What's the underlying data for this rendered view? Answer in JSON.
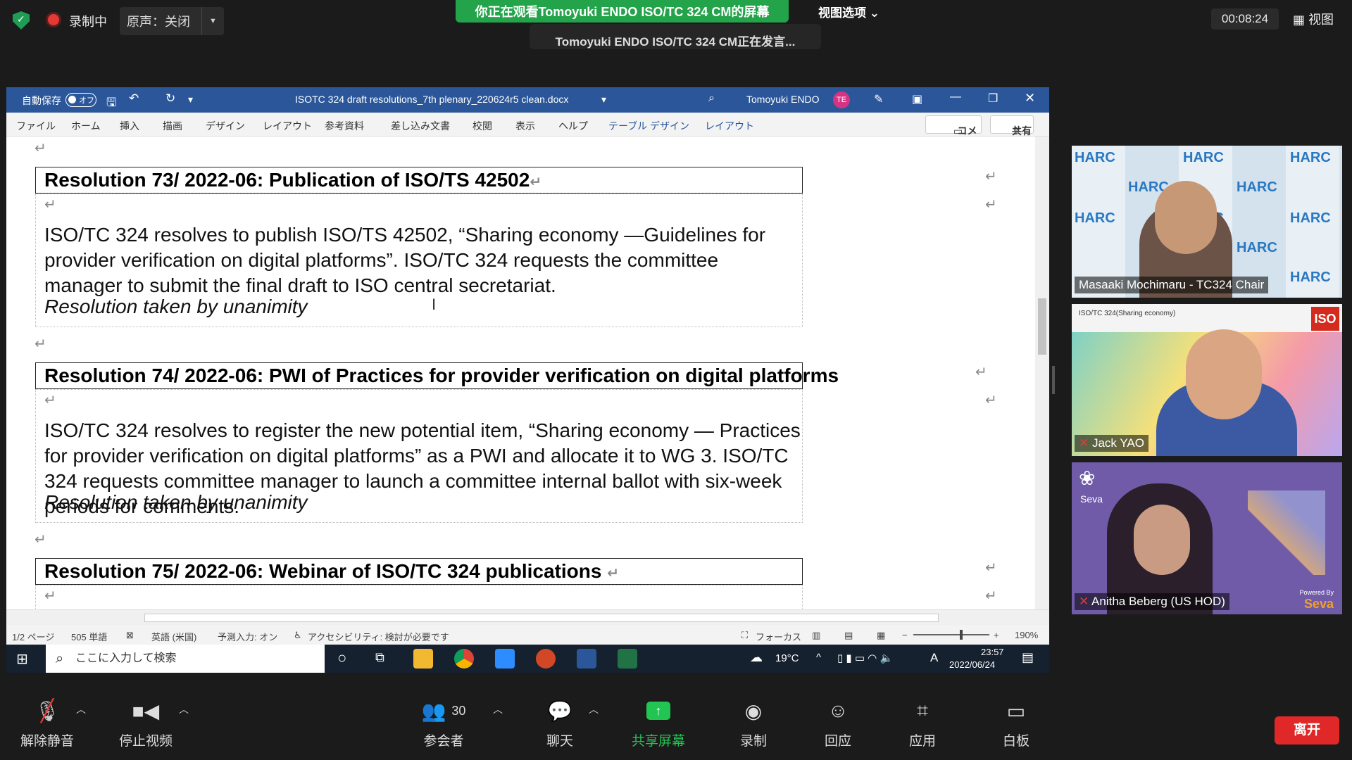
{
  "topbar": {
    "recording": "录制中",
    "original_sound": "原声：关闭",
    "viewing_banner": "你正在观看Tomoyuki ENDO ISO/TC 324 CM的屏幕",
    "speaking_banner": "Tomoyuki ENDO ISO/TC 324 CM正在发言...",
    "view_options": "视图选项 ⌄",
    "timer": "00:08:24",
    "view_button": "视图"
  },
  "word": {
    "autosave_label": "自動保存",
    "autosave_state": "オフ",
    "doc_title": "ISOTC 324 draft resolutions_7th plenary_220624r5 clean.docx",
    "user_name": "Tomoyuki ENDO",
    "user_initials": "TE",
    "menu": [
      "ファイル",
      "ホーム",
      "挿入",
      "描画",
      "デザイン",
      "レイアウト",
      "参考資料",
      "差し込み文書",
      "校閲",
      "表示",
      "ヘルプ",
      "テーブル デザイン",
      "レイアウト"
    ],
    "comment_button": "コメント",
    "share_button": "共有",
    "paragraph_mark": "↵",
    "resolutions": [
      {
        "heading": "Resolution 73/ 2022-06: Publication of ISO/TS 42502",
        "body": "ISO/TC 324 resolves to publish ISO/TS 42502, “Sharing economy —Guidelines for provider verification on digital platforms”. ISO/TC 324 requests the committee manager to submit the final draft to ISO central secretariat.",
        "taken": "Resolution taken by unanimity"
      },
      {
        "heading": "Resolution 74/ 2022-06: PWI of Practices for provider verification on digital platforms",
        "body": "ISO/TC 324 resolves to register the new potential item, “Sharing economy — Practices for provider verification on digital platforms” as a PWI and allocate it to WG 3. ISO/TC 324 requests committee manager to launch a committee internal ballot with six-week periods for comments.",
        "taken": "Resolution taken by unanimity"
      },
      {
        "heading": "Resolution 75/ 2022-06: Webinar of ISO/TC 324 publications"
      }
    ],
    "status": {
      "page": "1/2 ページ",
      "words": "505 単語",
      "language": "英語 (米国)",
      "predict": "予測入力: オン",
      "accessibility": "アクセシビリティ: 検討が必要です",
      "focus": "フォーカス",
      "zoom": "190%"
    },
    "taskbar": {
      "search_placeholder": "ここに入力して検索",
      "weather": "19°C",
      "ime": "A",
      "time": "23:57",
      "date": "2022/06/24"
    }
  },
  "participants": [
    {
      "name": "Masaaki Mochimaru - TC324 Chair",
      "bg": "#dfeaf3"
    },
    {
      "name": "Jack YAO",
      "bg": "#f4f4f4"
    },
    {
      "name": "Anitha Beberg (US HOD)",
      "bg": "#6f5ba8"
    }
  ],
  "participant_labels": {
    "harc": "HARC",
    "iso_header": "ISO/TC 324(Sharing economy)",
    "iso_logo": "ISO",
    "seva": "Seva",
    "powered_by": "Powered By",
    "seva_x": "Seva"
  },
  "bottombar": {
    "unmute": "解除静音",
    "stop_video": "停止视频",
    "participants": "参会者",
    "participants_count": "30",
    "chat": "聊天",
    "share_screen": "共享屏幕",
    "record": "录制",
    "reactions": "回应",
    "apps": "应用",
    "whiteboard": "白板",
    "leave": "离开"
  },
  "colors": {
    "word_blue": "#2b579a",
    "banner_green": "#23a34a",
    "leave_red": "#e02828",
    "share_green": "#23c552"
  }
}
